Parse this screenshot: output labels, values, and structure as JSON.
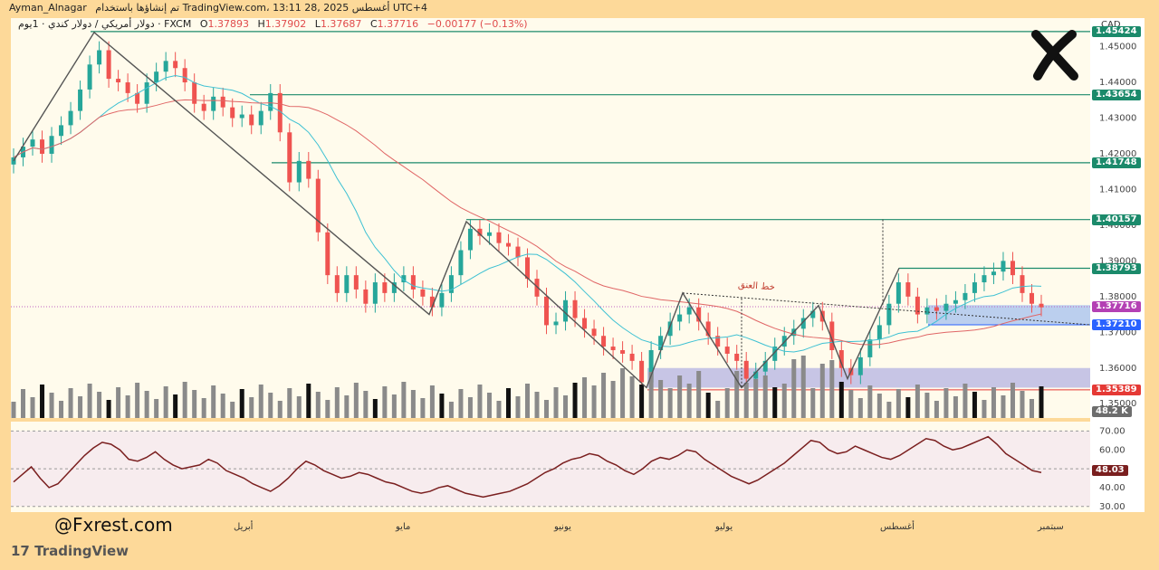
{
  "header": {
    "user": "Ayman_Alnagar",
    "published": "تم إنشاؤها باستخدام TradingView.com، 13:11 28, أغسطس 2025 UTC+4",
    "symbol_line": "دولار أمريكي / دولار كندي · 1يوم · FXCM",
    "o_label": "O",
    "o_value": "1.37893",
    "h_label": "H",
    "h_value": "1.37902",
    "l_label": "L",
    "l_value": "1.37687",
    "c_label": "C",
    "c_value": "1.37716",
    "change": "−0.00177 (−0.13%)"
  },
  "currency": "CAD",
  "annotation": "خط العنق",
  "volume_label": "48.2 K",
  "rsi_label": "48.03",
  "watermark": "@Fxrest.com",
  "tv_brand": "TradingView",
  "colors": {
    "bull": "#26a69a",
    "bear": "#ef5350",
    "level": "#1b8a6b",
    "ma_fast": "#3ec1d3",
    "ma_slow": "#e06666",
    "rsi": "#7a1f1f"
  },
  "chart_data": [
    {
      "type": "candlestick",
      "title": "",
      "x": [
        "أبريل",
        "مايو",
        "يونيو",
        "يوليو",
        "أغسطس",
        "سبتمبر"
      ],
      "y_ticks": [
        "1.45000",
        "1.44000",
        "1.43000",
        "1.42000",
        "1.41000",
        "1.40000",
        "1.39000",
        "1.38000",
        "1.37000",
        "1.36000",
        "1.35000"
      ],
      "ylim": [
        1.346,
        1.458
      ],
      "levels": [
        {
          "label": "1.45424",
          "value": 1.45424
        },
        {
          "label": "1.43654",
          "value": 1.43654
        },
        {
          "label": "1.41748",
          "value": 1.41748
        },
        {
          "label": "1.40157",
          "value": 1.40157
        },
        {
          "label": "1.38793",
          "value": 1.38793
        },
        {
          "label": "1.37716",
          "value": 1.37716
        },
        {
          "label": "1.37210",
          "value": 1.3721
        },
        {
          "label": "1.35389",
          "value": 1.35389
        }
      ],
      "zigzag": [
        1.418,
        1.454,
        1.375,
        1.401,
        1.3545,
        1.381,
        1.3545,
        1.3775,
        1.357,
        1.388
      ],
      "close_series": [
        1.419,
        1.422,
        1.424,
        1.42,
        1.425,
        1.428,
        1.432,
        1.438,
        1.445,
        1.449,
        1.441,
        1.44,
        1.437,
        1.434,
        1.44,
        1.443,
        1.446,
        1.444,
        1.44,
        1.434,
        1.432,
        1.436,
        1.433,
        1.43,
        1.431,
        1.428,
        1.432,
        1.437,
        1.426,
        1.412,
        1.418,
        1.413,
        1.398,
        1.386,
        1.381,
        1.386,
        1.382,
        1.378,
        1.384,
        1.381,
        1.384,
        1.386,
        1.382,
        1.38,
        1.377,
        1.381,
        1.386,
        1.393,
        1.399,
        1.397,
        1.398,
        1.395,
        1.394,
        1.391,
        1.385,
        1.38,
        1.372,
        1.373,
        1.379,
        1.374,
        1.371,
        1.369,
        1.366,
        1.365,
        1.364,
        1.362,
        1.356,
        1.365,
        1.369,
        1.373,
        1.375,
        1.377,
        1.373,
        1.369,
        1.366,
        1.364,
        1.362,
        1.357,
        1.359,
        1.362,
        1.366,
        1.369,
        1.371,
        1.374,
        1.376,
        1.373,
        1.365,
        1.36,
        1.358,
        1.363,
        1.368,
        1.372,
        1.378,
        1.384,
        1.38,
        1.375,
        1.377,
        1.376,
        1.378,
        1.379,
        1.381,
        1.384,
        1.386,
        1.387,
        1.39,
        1.386,
        1.381,
        1.378,
        1.377
      ]
    },
    {
      "type": "line",
      "title": "",
      "y_ticks": [
        "70.00",
        "60.00",
        "50.00",
        "40.00",
        "30.00"
      ],
      "ylim": [
        27,
        75
      ],
      "values": [
        43,
        47,
        51,
        45,
        40,
        42,
        47,
        52,
        57,
        61,
        64,
        63,
        60,
        55,
        54,
        56,
        59,
        55,
        52,
        50,
        51,
        52,
        55,
        53,
        49,
        47,
        45,
        42,
        40,
        38,
        41,
        45,
        50,
        54,
        52,
        49,
        47,
        45,
        46,
        48,
        47,
        45,
        43,
        42,
        40,
        38,
        37,
        38,
        40,
        41,
        39,
        37,
        36,
        35,
        36,
        37,
        38,
        40,
        42,
        45,
        48,
        50,
        53,
        55,
        56,
        58,
        57,
        54,
        52,
        49,
        47,
        50,
        54,
        56,
        55,
        57,
        60,
        59,
        55,
        52,
        49,
        46,
        44,
        42,
        44,
        47,
        50,
        53,
        57,
        61,
        65,
        64,
        60,
        58,
        59,
        62,
        60,
        58,
        56,
        55,
        57,
        60,
        63,
        66,
        65,
        62,
        60,
        61,
        63,
        65,
        67,
        63,
        58,
        55,
        52,
        49,
        48
      ]
    }
  ]
}
